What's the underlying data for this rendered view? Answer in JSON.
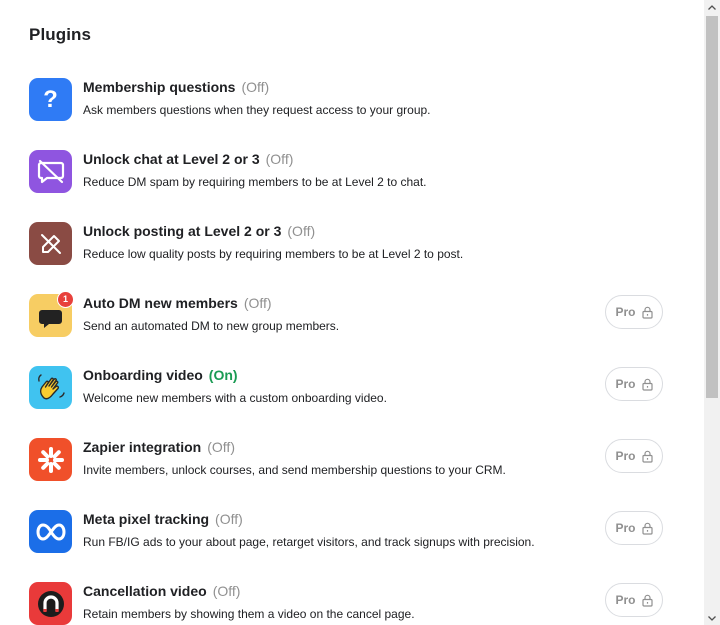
{
  "page": {
    "title": "Plugins"
  },
  "colors": {
    "status_off": "#909090",
    "status_on": "#1a9b53",
    "badge_text": "#909090"
  },
  "plugins": [
    {
      "name": "Membership questions",
      "status": "(Off)",
      "description": "Ask members questions when they request access to your group.",
      "icon": "question-mark-icon",
      "icon_bg": "#2f7bf5",
      "pro": ""
    },
    {
      "name": "Unlock chat at Level 2 or 3",
      "status": "(Off)",
      "description": "Reduce DM spam by requiring members to be at Level 2 to chat.",
      "icon": "chat-off-icon",
      "icon_bg": "#8f55e0",
      "pro": ""
    },
    {
      "name": "Unlock posting at Level 2 or 3",
      "status": "(Off)",
      "description": "Reduce low quality posts by requiring members to be at Level 2 to post.",
      "icon": "pencil-off-icon",
      "icon_bg": "#8a4b44",
      "pro": ""
    },
    {
      "name": "Auto DM new members",
      "status": "(Off)",
      "description": "Send an automated DM to new group members.",
      "icon": "speech-bubble-notification-icon",
      "icon_bg": "#f7cd63",
      "badge_count": "1",
      "pro": "Pro"
    },
    {
      "name": "Onboarding video",
      "status": "(On)",
      "description": "Welcome new members with a custom onboarding video.",
      "icon": "waving-hand-icon",
      "icon_bg": "#40c3f0",
      "pro": "Pro"
    },
    {
      "name": "Zapier integration",
      "status": "(Off)",
      "description": "Invite members, unlock courses, and send membership questions to your CRM.",
      "icon": "zapier-asterisk-icon",
      "icon_bg": "#f0502a",
      "pro": "Pro"
    },
    {
      "name": "Meta pixel tracking",
      "status": "(Off)",
      "description": "Run FB/IG ads to your about page, retarget visitors, and track signups with precision.",
      "icon": "meta-infinity-icon",
      "icon_bg": "#1b6ee8",
      "pro": "Pro"
    },
    {
      "name": "Cancellation video",
      "status": "(Off)",
      "description": "Retain members by showing them a video on the cancel page.",
      "icon": "magnet-icon",
      "icon_bg": "#e93a3a",
      "pro": "Pro"
    }
  ]
}
